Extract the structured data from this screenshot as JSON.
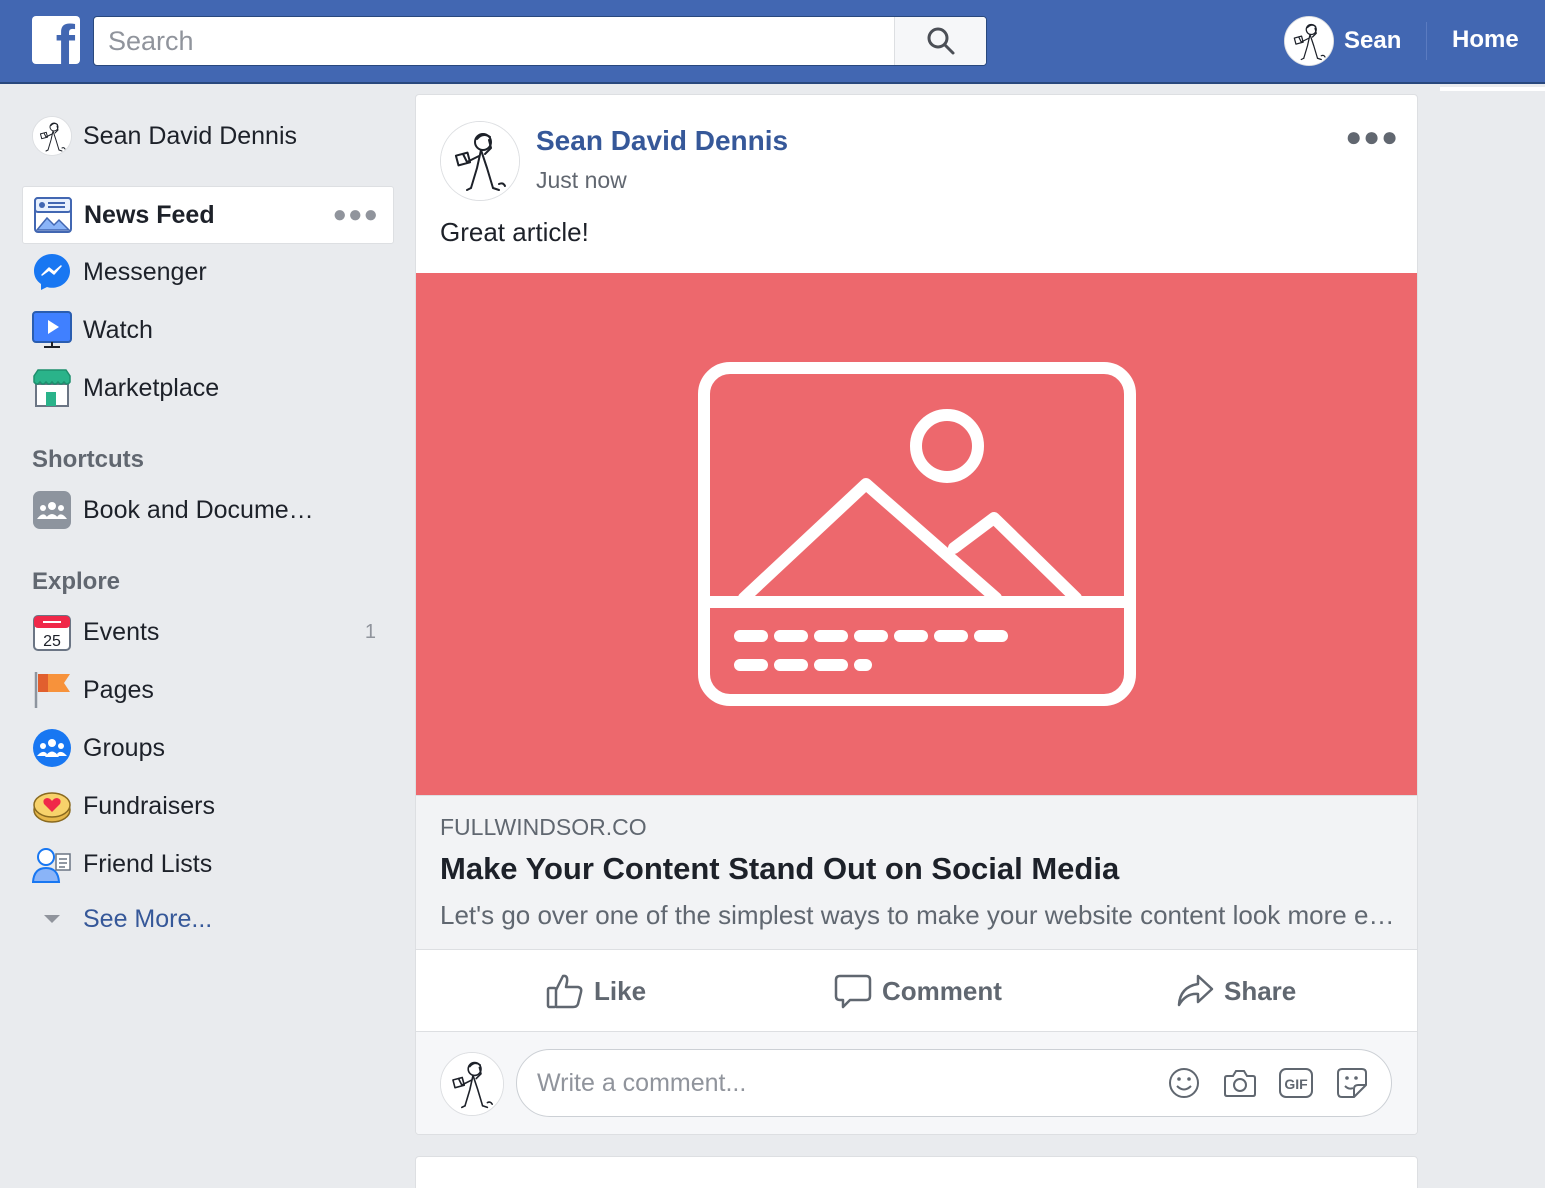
{
  "header": {
    "logo_letter": "f",
    "search_placeholder": "Search",
    "user_name": "Sean",
    "home_label": "Home"
  },
  "sidebar": {
    "profile_name": "Sean David Dennis",
    "main_items": [
      {
        "label": "News Feed",
        "icon": "news-feed-icon",
        "active": true
      },
      {
        "label": "Messenger",
        "icon": "messenger-icon"
      },
      {
        "label": "Watch",
        "icon": "watch-icon"
      },
      {
        "label": "Marketplace",
        "icon": "marketplace-icon"
      }
    ],
    "shortcuts_heading": "Shortcuts",
    "shortcuts": [
      {
        "label": "Book and Docume…",
        "icon": "group-icon"
      }
    ],
    "explore_heading": "Explore",
    "explore": [
      {
        "label": "Events",
        "icon": "calendar-icon",
        "count": "1",
        "calendar_day": "25"
      },
      {
        "label": "Pages",
        "icon": "flag-icon"
      },
      {
        "label": "Groups",
        "icon": "groups-icon"
      },
      {
        "label": "Fundraisers",
        "icon": "fundraiser-icon"
      },
      {
        "label": "Friend Lists",
        "icon": "friend-lists-icon"
      }
    ],
    "see_more": "See More..."
  },
  "post": {
    "author": "Sean David Dennis",
    "timestamp": "Just now",
    "text": "Great article!",
    "link": {
      "domain": "FULLWINDSOR.CO",
      "title": "Make Your Content Stand Out on Social Media",
      "description": "Let's go over one of the simplest ways to make your website content look more engaging and professional when shared on social media."
    },
    "actions": {
      "like": "Like",
      "comment": "Comment",
      "share": "Share"
    },
    "comment_placeholder": "Write a comment..."
  },
  "colors": {
    "brand_blue": "#4267b2",
    "link_blue": "#365899",
    "image_placeholder": "#ed686d",
    "background": "#e9ebee"
  }
}
